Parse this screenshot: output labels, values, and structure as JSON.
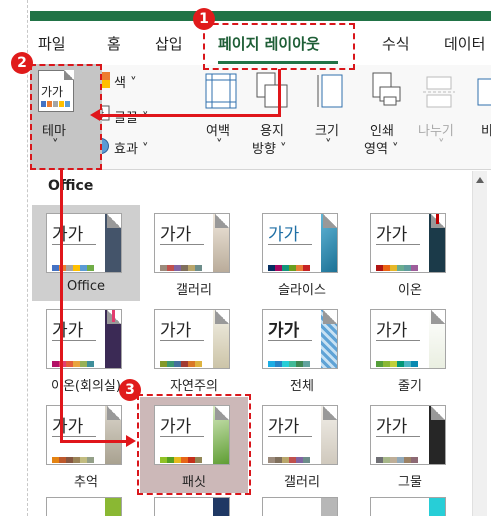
{
  "tabs": [
    {
      "label": "파일"
    },
    {
      "label": "홈"
    },
    {
      "label": "삽입"
    },
    {
      "label": "페이지 레이아웃"
    },
    {
      "label": "수식"
    },
    {
      "label": "데이터"
    }
  ],
  "ribbon": {
    "theme_label": "테마",
    "theme_thumb_text": "가가",
    "colors_label": "색 ˅",
    "fonts_label": "글꼴 ˅",
    "effects_label": "효과 ˅",
    "margins_line1": "여백",
    "orientation_line1": "용지",
    "orientation_line2": "방향 ˅",
    "size_line1": "크기",
    "print_area_line1": "인쇄",
    "print_area_line2": "영역 ˅",
    "breaks_line1": "나누기",
    "chevron": "˅"
  },
  "gallery": {
    "section_title": "Office",
    "preview_text": "가가",
    "themes": [
      {
        "label": "Office"
      },
      {
        "label": "갤러리"
      },
      {
        "label": "슬라이스"
      },
      {
        "label": "이온"
      },
      {
        "label": "이온(회의실)"
      },
      {
        "label": "자연주의"
      },
      {
        "label": "전체"
      },
      {
        "label": "줄기"
      },
      {
        "label": "추억"
      },
      {
        "label": "패싯"
      },
      {
        "label": "갤러리"
      },
      {
        "label": "그물"
      }
    ]
  },
  "annotations": {
    "step1": "1",
    "step2": "2",
    "step3": "3"
  },
  "colors": {
    "accent": "#217346",
    "highlight": "#e0161b"
  }
}
